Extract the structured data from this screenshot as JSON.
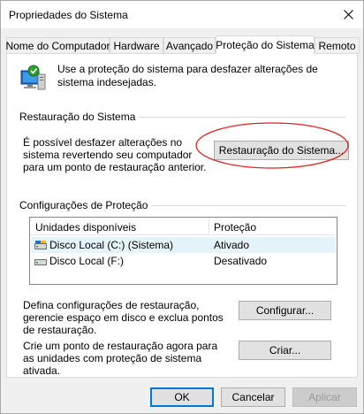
{
  "window": {
    "title": "Propriedades do Sistema"
  },
  "tabs": [
    {
      "label": "Nome do Computador"
    },
    {
      "label": "Hardware"
    },
    {
      "label": "Avançado"
    },
    {
      "label": "Proteção do Sistema",
      "active": true
    },
    {
      "label": "Remoto"
    }
  ],
  "intro": {
    "text": "Use a proteção do sistema para desfazer alterações de sistema indesejadas."
  },
  "restore": {
    "section_label": "Restauração do Sistema",
    "description": "É possível desfazer alterações no sistema revertendo seu computador para um ponto de restauração anterior.",
    "button_label": "Restauração do Sistema..."
  },
  "protection": {
    "section_label": "Configurações de Proteção",
    "columns": [
      "Unidades disponíveis",
      "Proteção"
    ],
    "drives": [
      {
        "name": "Disco Local (C:) (Sistema)",
        "status": "Ativado",
        "icon": "system-drive-icon",
        "selected": true
      },
      {
        "name": "Disco Local (F:)",
        "status": "Desativado",
        "icon": "drive-icon",
        "selected": false
      }
    ],
    "configure_text": "Defina configurações de restauração, gerencie espaço em disco e exclua pontos de restauração.",
    "configure_button": "Configurar...",
    "create_text": "Crie um ponto de restauração agora para as unidades com proteção de sistema ativada.",
    "create_button": "Criar..."
  },
  "footer": {
    "ok": "OK",
    "cancel": "Cancelar",
    "apply": "Aplicar"
  },
  "colors": {
    "annotation": "#e0201b",
    "accent": "#0078d7",
    "selection": "#e5f3fb"
  }
}
